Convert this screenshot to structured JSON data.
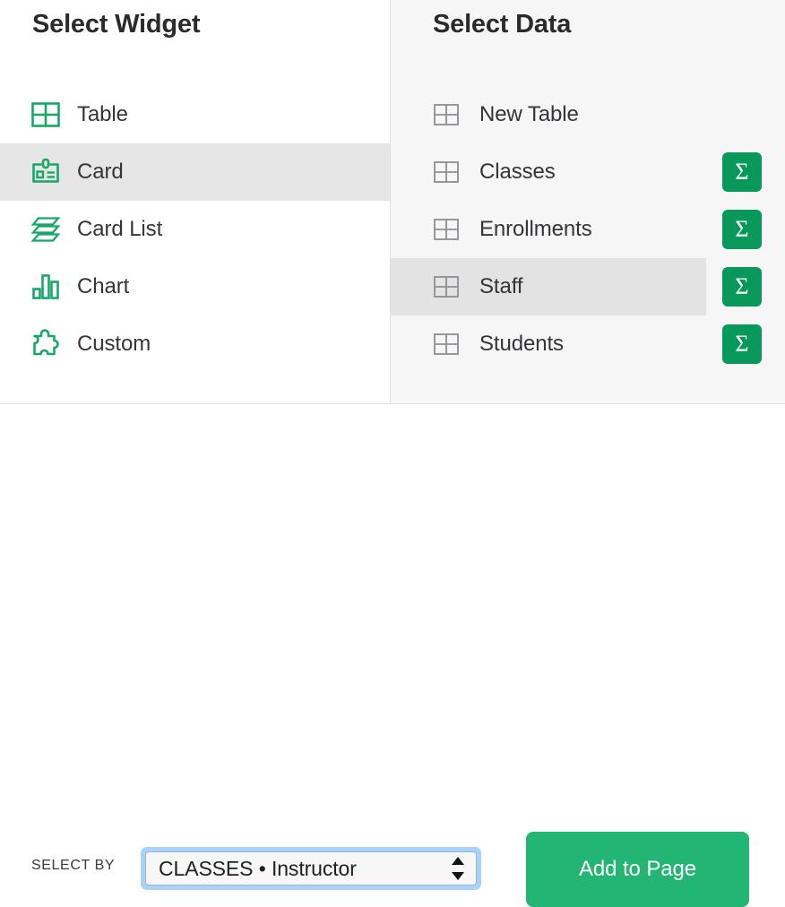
{
  "widget_panel": {
    "title": "Select Widget",
    "options": [
      {
        "label": "Table",
        "icon": "table-grid-icon",
        "selected": false
      },
      {
        "label": "Card",
        "icon": "id-card-icon",
        "selected": true
      },
      {
        "label": "Card List",
        "icon": "card-stack-icon",
        "selected": false
      },
      {
        "label": "Chart",
        "icon": "bar-chart-icon",
        "selected": false
      },
      {
        "label": "Custom",
        "icon": "puzzle-piece-icon",
        "selected": false
      }
    ]
  },
  "data_panel": {
    "title": "Select Data",
    "options": [
      {
        "label": "New Table",
        "icon": "table-grid-icon",
        "selected": false,
        "has_summary": false,
        "summary_label": ""
      },
      {
        "label": "Classes",
        "icon": "table-grid-icon",
        "selected": false,
        "has_summary": true,
        "summary_label": "Σ"
      },
      {
        "label": "Enrollments",
        "icon": "table-grid-icon",
        "selected": false,
        "has_summary": true,
        "summary_label": "Σ"
      },
      {
        "label": "Staff",
        "icon": "table-grid-icon",
        "selected": true,
        "has_summary": true,
        "summary_label": "Σ"
      },
      {
        "label": "Students",
        "icon": "table-grid-icon",
        "selected": false,
        "has_summary": true,
        "summary_label": "Σ"
      }
    ]
  },
  "footer": {
    "select_by_label": "SELECT BY",
    "select_by_value": "CLASSES • Instructor",
    "add_button_label": "Add to Page"
  },
  "colors": {
    "accent_green": "#22b573",
    "icon_green": "#17a866",
    "summary_green": "#08985a",
    "focus_blue": "#a9d2f7",
    "selected_row_left": "#e6e6e6",
    "selected_row_right": "#e3e3e3",
    "panel_bg_right": "#f6f6f6",
    "text_dark": "#32363a",
    "icon_gray": "#8e8e93"
  }
}
